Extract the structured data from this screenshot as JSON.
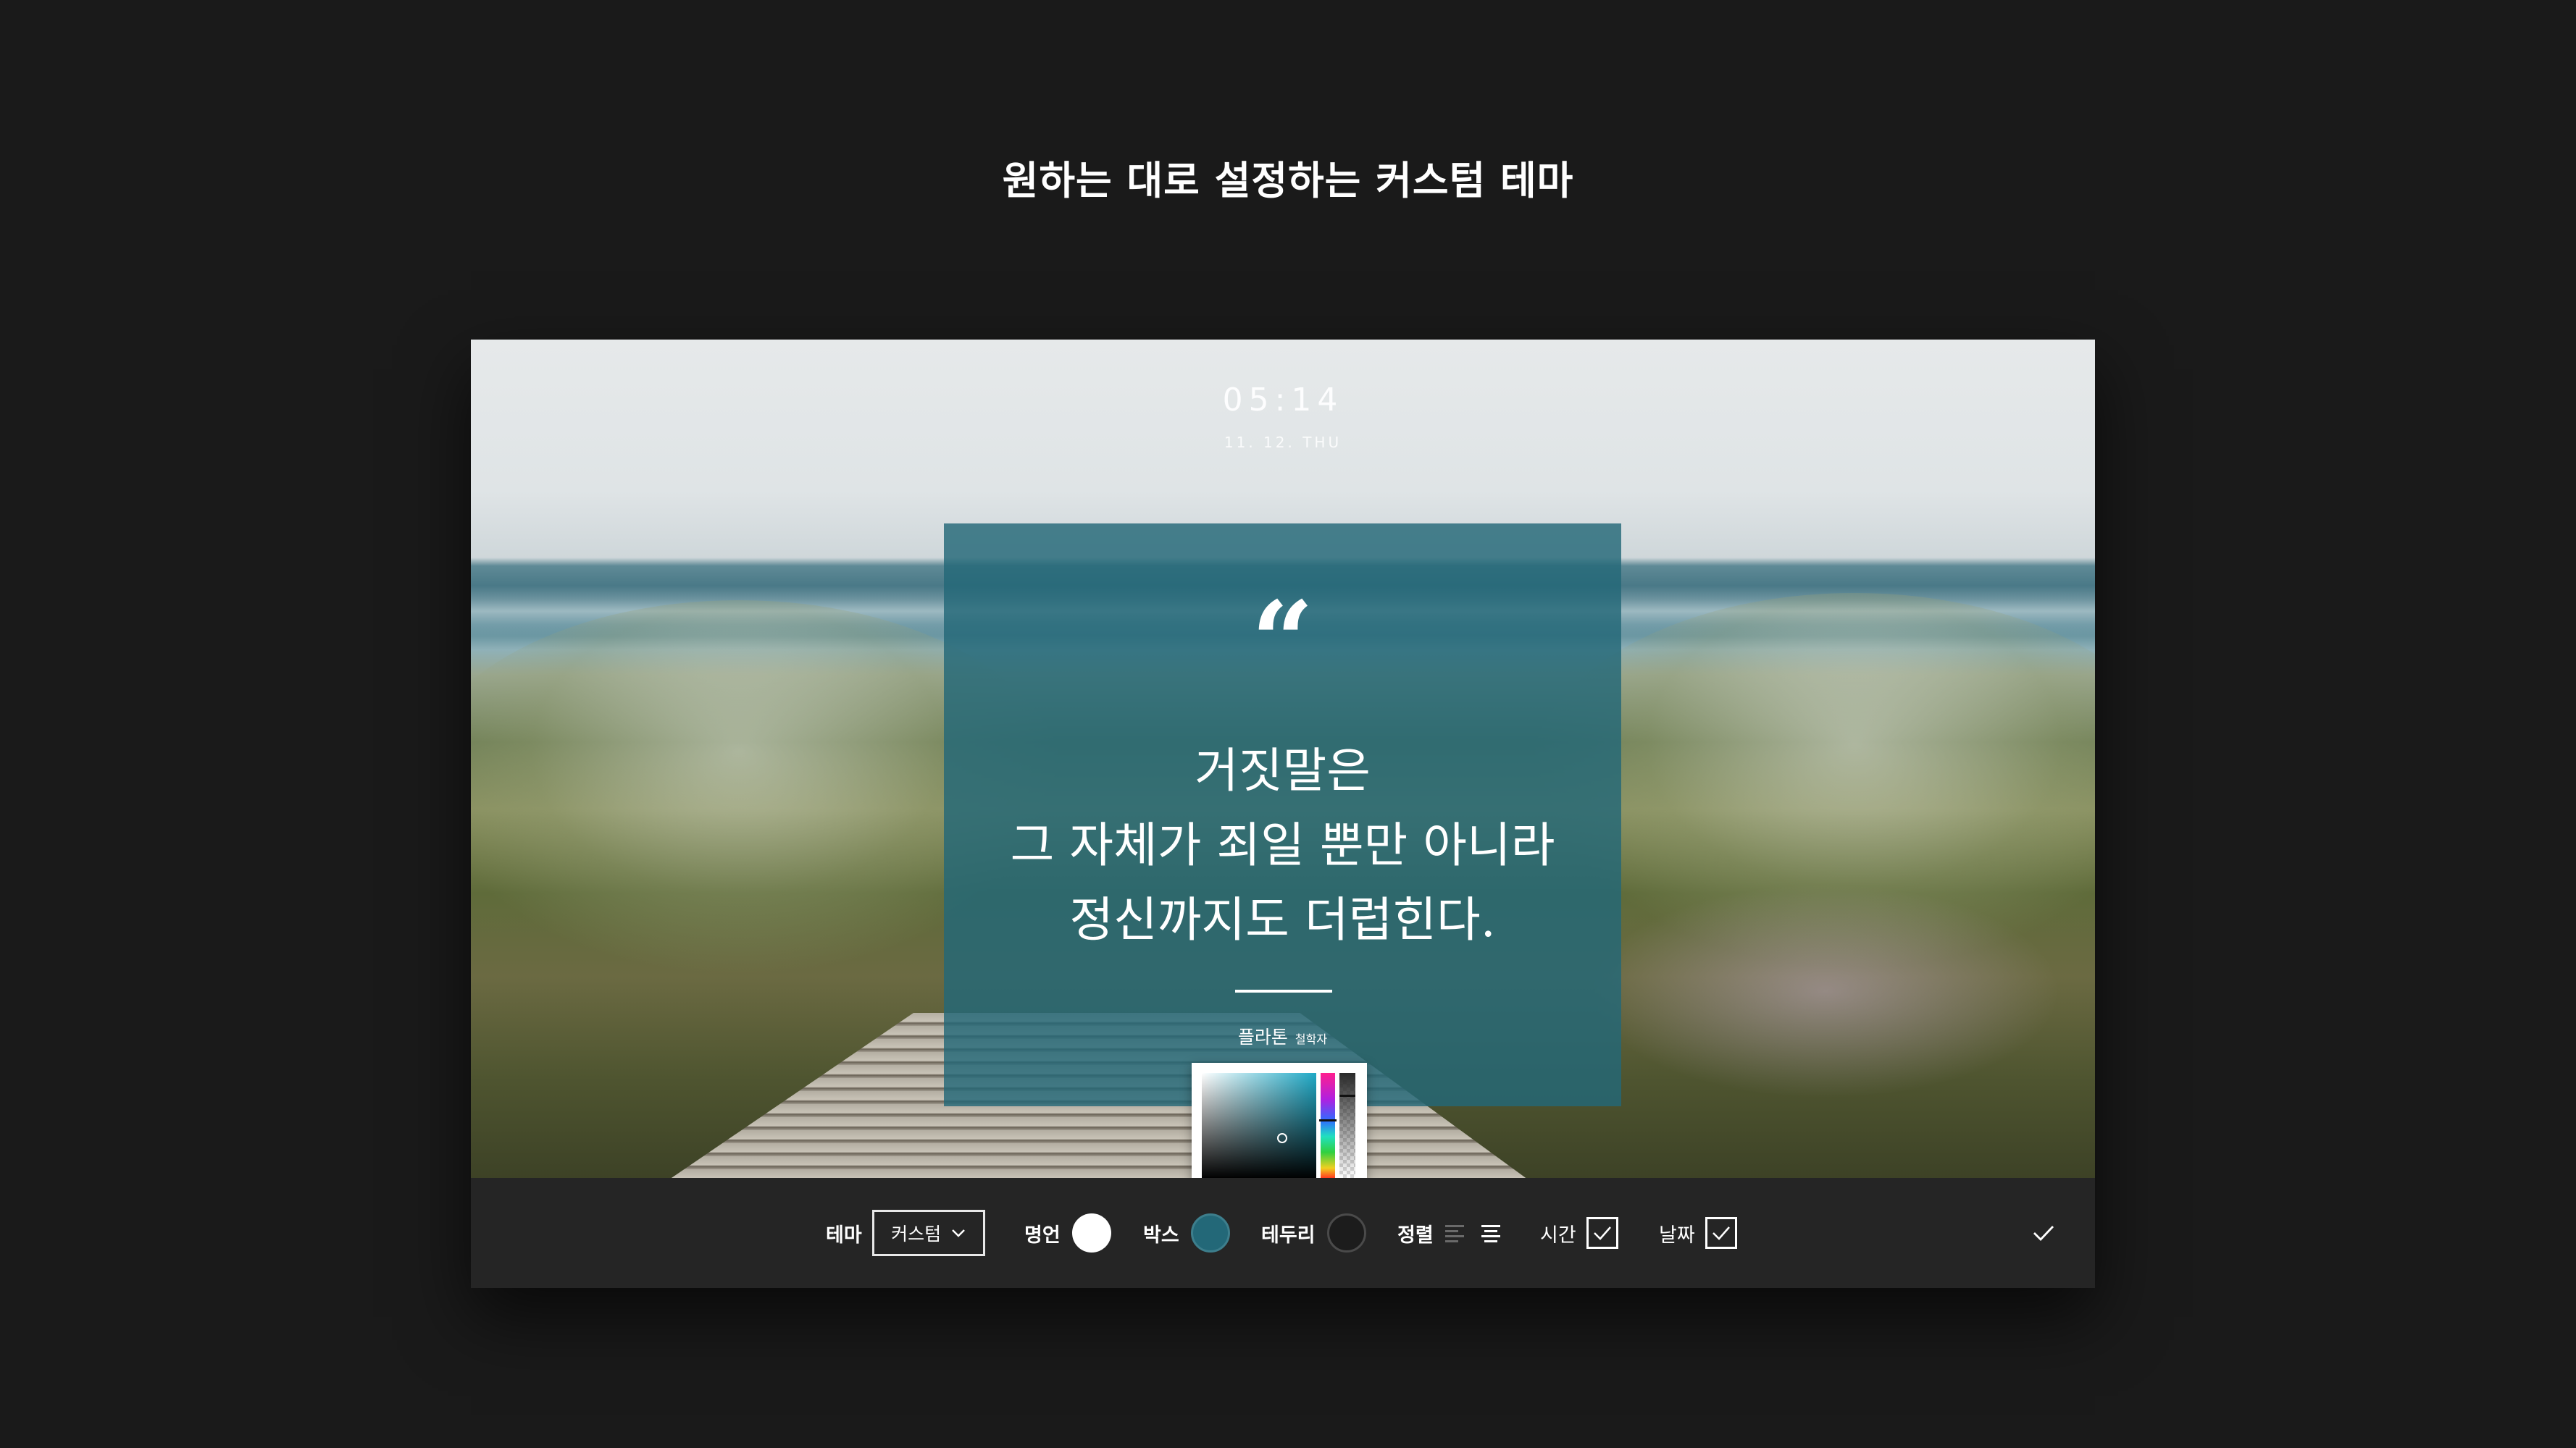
{
  "page": {
    "heading": "원하는 대로 설정하는 커스텀 테마"
  },
  "preview": {
    "clock": "05:14",
    "date": "11. 12. THU",
    "quote": {
      "mark": "“",
      "lines": [
        "거짓말은",
        "그 자체가 죄일 뿐만 아니라",
        "정신까지도 더럽힌다."
      ],
      "author": "플라톤",
      "author_role": "철학자"
    }
  },
  "color_picker": {
    "selected_color": "#1fa9c6"
  },
  "toolbar": {
    "theme_label": "테마",
    "theme_value": "커스텀",
    "quote_label": "명언",
    "quote_color": "#ffffff",
    "box_label": "박스",
    "box_color": "#236878",
    "border_label": "테두리",
    "border_color": "#1c1c1c",
    "align_label": "정렬",
    "align_options": [
      "align-left-icon",
      "align-center-icon"
    ],
    "align_selected": "center",
    "time_label": "시간",
    "time_checked": true,
    "date_label": "날짜",
    "date_checked": true,
    "confirm_icon": "check-icon"
  }
}
